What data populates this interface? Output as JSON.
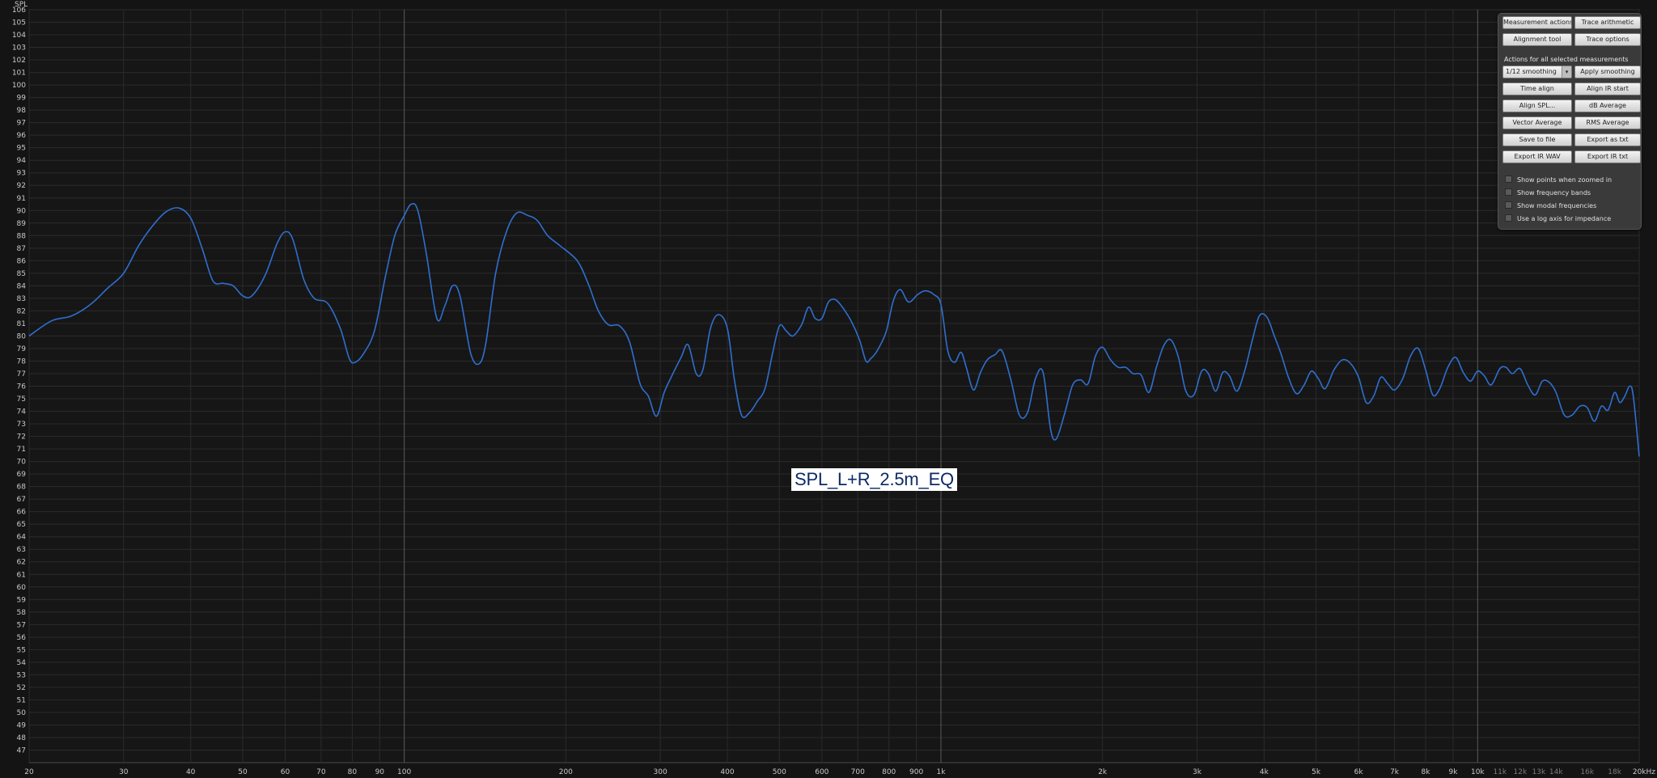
{
  "panel": {
    "buttons_top": [
      {
        "label": "Measurement actions"
      },
      {
        "label": "Trace arithmetic"
      },
      {
        "label": "Alignment tool"
      },
      {
        "label": "Trace options"
      }
    ],
    "section_title": "Actions for all selected measurements",
    "smoothing_select": "1/12 smoothing",
    "apply_smoothing": "Apply smoothing",
    "buttons_actions": [
      {
        "label": "Time align"
      },
      {
        "label": "Align IR start"
      },
      {
        "label": "Align SPL..."
      },
      {
        "label": "dB Average"
      },
      {
        "label": "Vector Average"
      },
      {
        "label": "RMS Average"
      },
      {
        "label": "Save to file"
      },
      {
        "label": "Export as txt"
      },
      {
        "label": "Export IR WAV"
      },
      {
        "label": "Export IR txt"
      }
    ],
    "checkboxes": [
      {
        "label": "Show points when zoomed in",
        "checked": false
      },
      {
        "label": "Show frequency bands",
        "checked": false
      },
      {
        "label": "Show modal frequencies",
        "checked": false
      },
      {
        "label": "Use a log axis for impedance",
        "checked": false
      }
    ]
  },
  "chart_data": {
    "type": "line",
    "title": "",
    "xlabel": "",
    "ylabel": "SPL",
    "xscale": "log",
    "xlim": [
      20,
      20000
    ],
    "ylim": [
      46,
      106
    ],
    "grid": true,
    "trace_label": "SPL_L+R_2.5m_EQ",
    "x_ticks": [
      {
        "value": 20,
        "label": "20"
      },
      {
        "value": 30,
        "label": "30"
      },
      {
        "value": 40,
        "label": "40"
      },
      {
        "value": 50,
        "label": "50"
      },
      {
        "value": 60,
        "label": "60"
      },
      {
        "value": 70,
        "label": "70"
      },
      {
        "value": 80,
        "label": "80"
      },
      {
        "value": 90,
        "label": "90"
      },
      {
        "value": 100,
        "label": "100"
      },
      {
        "value": 200,
        "label": "200"
      },
      {
        "value": 300,
        "label": "300"
      },
      {
        "value": 400,
        "label": "400"
      },
      {
        "value": 500,
        "label": "500"
      },
      {
        "value": 600,
        "label": "600"
      },
      {
        "value": 700,
        "label": "700"
      },
      {
        "value": 800,
        "label": "800"
      },
      {
        "value": 900,
        "label": "900"
      },
      {
        "value": 1000,
        "label": "1k"
      },
      {
        "value": 2000,
        "label": "2k"
      },
      {
        "value": 3000,
        "label": "3k"
      },
      {
        "value": 4000,
        "label": "4k"
      },
      {
        "value": 5000,
        "label": "5k"
      },
      {
        "value": 6000,
        "label": "6k"
      },
      {
        "value": 7000,
        "label": "7k"
      },
      {
        "value": 8000,
        "label": "8k"
      },
      {
        "value": 9000,
        "label": "9k"
      },
      {
        "value": 10000,
        "label": "10k"
      },
      {
        "value": 11000,
        "label": "11k"
      },
      {
        "value": 12000,
        "label": "12k"
      },
      {
        "value": 13000,
        "label": "13k"
      },
      {
        "value": 14000,
        "label": "14k"
      },
      {
        "value": 16000,
        "label": "16k"
      },
      {
        "value": 18000,
        "label": "18k"
      },
      {
        "value": 20000,
        "label": "20kHz"
      }
    ],
    "minor_tick_labels": [
      "11k",
      "12k",
      "13k",
      "14k",
      "16k",
      "18k"
    ],
    "major_gridlines": [
      100,
      1000,
      10000
    ],
    "y_ticks": [
      47,
      48,
      49,
      50,
      51,
      52,
      53,
      54,
      55,
      56,
      57,
      58,
      59,
      60,
      61,
      62,
      63,
      64,
      65,
      66,
      67,
      68,
      69,
      70,
      71,
      72,
      73,
      74,
      75,
      76,
      77,
      78,
      79,
      80,
      81,
      82,
      83,
      84,
      85,
      86,
      87,
      88,
      89,
      90,
      91,
      92,
      93,
      94,
      95,
      96,
      97,
      98,
      99,
      100,
      101,
      102,
      103,
      104,
      105,
      106
    ],
    "series": [
      {
        "name": "SPL_L+R_2.5m_EQ",
        "color": "#2f6fcf",
        "points": [
          [
            20,
            80.0
          ],
          [
            22,
            81.2
          ],
          [
            24,
            81.6
          ],
          [
            26,
            82.5
          ],
          [
            28,
            83.8
          ],
          [
            30,
            85.0
          ],
          [
            32,
            87.2
          ],
          [
            34,
            88.8
          ],
          [
            36,
            89.9
          ],
          [
            38,
            90.2
          ],
          [
            40,
            89.4
          ],
          [
            42,
            87.0
          ],
          [
            44,
            84.4
          ],
          [
            46,
            84.2
          ],
          [
            48,
            84.0
          ],
          [
            50,
            83.2
          ],
          [
            52,
            83.2
          ],
          [
            55,
            84.8
          ],
          [
            58,
            87.4
          ],
          [
            60,
            88.3
          ],
          [
            62,
            87.7
          ],
          [
            65,
            84.5
          ],
          [
            68,
            83.0
          ],
          [
            72,
            82.6
          ],
          [
            76,
            80.6
          ],
          [
            79,
            78.2
          ],
          [
            81,
            77.9
          ],
          [
            84,
            78.6
          ],
          [
            88,
            80.4
          ],
          [
            92,
            84.5
          ],
          [
            96,
            88.0
          ],
          [
            100,
            89.6
          ],
          [
            103,
            90.5
          ],
          [
            106,
            90.0
          ],
          [
            110,
            86.5
          ],
          [
            115,
            81.4
          ],
          [
            119,
            82.4
          ],
          [
            123,
            84.0
          ],
          [
            127,
            83.2
          ],
          [
            133,
            78.6
          ],
          [
            138,
            77.8
          ],
          [
            142,
            79.5
          ],
          [
            148,
            85.0
          ],
          [
            155,
            88.3
          ],
          [
            162,
            89.8
          ],
          [
            170,
            89.6
          ],
          [
            177,
            89.2
          ],
          [
            185,
            88.0
          ],
          [
            195,
            87.2
          ],
          [
            210,
            86.0
          ],
          [
            220,
            84.2
          ],
          [
            230,
            82.0
          ],
          [
            240,
            80.9
          ],
          [
            252,
            80.8
          ],
          [
            263,
            79.5
          ],
          [
            275,
            76.2
          ],
          [
            285,
            75.2
          ],
          [
            295,
            73.6
          ],
          [
            305,
            75.5
          ],
          [
            315,
            76.8
          ],
          [
            328,
            78.3
          ],
          [
            338,
            79.3
          ],
          [
            350,
            77.0
          ],
          [
            360,
            77.3
          ],
          [
            372,
            80.6
          ],
          [
            385,
            81.7
          ],
          [
            400,
            80.6
          ],
          [
            412,
            76.6
          ],
          [
            425,
            73.7
          ],
          [
            440,
            73.9
          ],
          [
            455,
            74.8
          ],
          [
            470,
            75.8
          ],
          [
            485,
            78.5
          ],
          [
            500,
            80.8
          ],
          [
            515,
            80.4
          ],
          [
            530,
            80.0
          ],
          [
            550,
            80.9
          ],
          [
            567,
            82.3
          ],
          [
            583,
            81.4
          ],
          [
            600,
            81.4
          ],
          [
            617,
            82.7
          ],
          [
            635,
            82.9
          ],
          [
            655,
            82.3
          ],
          [
            680,
            81.2
          ],
          [
            705,
            79.7
          ],
          [
            725,
            78.0
          ],
          [
            740,
            78.2
          ],
          [
            760,
            78.8
          ],
          [
            790,
            80.3
          ],
          [
            815,
            82.8
          ],
          [
            840,
            83.7
          ],
          [
            870,
            82.7
          ],
          [
            905,
            83.3
          ],
          [
            935,
            83.6
          ],
          [
            970,
            83.3
          ],
          [
            1000,
            82.5
          ],
          [
            1030,
            78.8
          ],
          [
            1060,
            77.9
          ],
          [
            1090,
            78.7
          ],
          [
            1115,
            77.5
          ],
          [
            1150,
            75.7
          ],
          [
            1185,
            77.1
          ],
          [
            1220,
            78.1
          ],
          [
            1260,
            78.5
          ],
          [
            1300,
            78.8
          ],
          [
            1350,
            76.5
          ],
          [
            1400,
            73.7
          ],
          [
            1450,
            73.9
          ],
          [
            1500,
            76.6
          ],
          [
            1550,
            77.1
          ],
          [
            1600,
            72.6
          ],
          [
            1640,
            71.8
          ],
          [
            1700,
            73.8
          ],
          [
            1760,
            76.1
          ],
          [
            1820,
            76.5
          ],
          [
            1880,
            76.2
          ],
          [
            1940,
            78.4
          ],
          [
            2000,
            79.1
          ],
          [
            2070,
            78.1
          ],
          [
            2140,
            77.5
          ],
          [
            2210,
            77.5
          ],
          [
            2280,
            77.0
          ],
          [
            2360,
            76.9
          ],
          [
            2440,
            75.5
          ],
          [
            2520,
            77.5
          ],
          [
            2600,
            79.2
          ],
          [
            2680,
            79.7
          ],
          [
            2770,
            78.3
          ],
          [
            2860,
            75.6
          ],
          [
            2960,
            75.3
          ],
          [
            3060,
            77.2
          ],
          [
            3150,
            77.0
          ],
          [
            3250,
            75.6
          ],
          [
            3350,
            77.1
          ],
          [
            3450,
            76.8
          ],
          [
            3560,
            75.6
          ],
          [
            3680,
            77.2
          ],
          [
            3800,
            79.6
          ],
          [
            3920,
            81.6
          ],
          [
            4050,
            81.5
          ],
          [
            4180,
            80.0
          ],
          [
            4300,
            78.6
          ],
          [
            4450,
            76.6
          ],
          [
            4600,
            75.4
          ],
          [
            4750,
            76.1
          ],
          [
            4900,
            77.2
          ],
          [
            5050,
            76.6
          ],
          [
            5200,
            75.8
          ],
          [
            5400,
            77.3
          ],
          [
            5600,
            78.1
          ],
          [
            5800,
            77.8
          ],
          [
            6000,
            76.7
          ],
          [
            6200,
            74.7
          ],
          [
            6400,
            75.2
          ],
          [
            6600,
            76.7
          ],
          [
            6800,
            76.2
          ],
          [
            7000,
            75.7
          ],
          [
            7250,
            76.6
          ],
          [
            7500,
            78.4
          ],
          [
            7750,
            79.0
          ],
          [
            8000,
            77.3
          ],
          [
            8250,
            75.3
          ],
          [
            8500,
            75.8
          ],
          [
            8800,
            77.5
          ],
          [
            9100,
            78.3
          ],
          [
            9400,
            77.1
          ],
          [
            9700,
            76.4
          ],
          [
            10000,
            77.2
          ],
          [
            10300,
            76.8
          ],
          [
            10600,
            76.1
          ],
          [
            11000,
            77.4
          ],
          [
            11300,
            77.5
          ],
          [
            11600,
            77.0
          ],
          [
            12000,
            77.4
          ],
          [
            12400,
            76.1
          ],
          [
            12800,
            75.3
          ],
          [
            13200,
            76.4
          ],
          [
            13600,
            76.3
          ],
          [
            14000,
            75.5
          ],
          [
            14500,
            73.7
          ],
          [
            15000,
            73.7
          ],
          [
            15500,
            74.4
          ],
          [
            16000,
            74.3
          ],
          [
            16500,
            73.2
          ],
          [
            17000,
            74.4
          ],
          [
            17500,
            74.1
          ],
          [
            18000,
            75.5
          ],
          [
            18400,
            74.7
          ],
          [
            18800,
            75.2
          ],
          [
            19200,
            76.0
          ],
          [
            19500,
            75.2
          ],
          [
            20000,
            70.4
          ]
        ]
      }
    ]
  }
}
